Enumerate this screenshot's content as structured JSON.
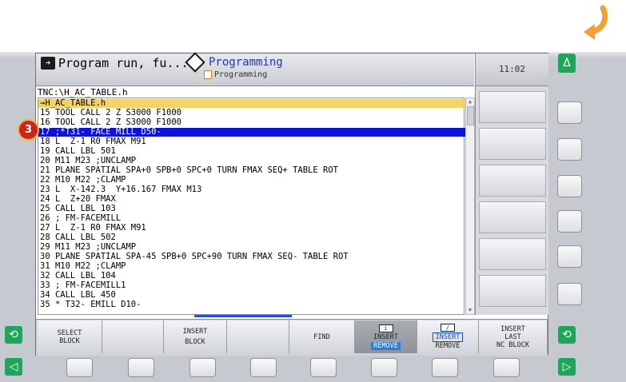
{
  "header": {
    "mode1_label": "Program run, fu...",
    "mode2_label": "Programming",
    "mode2_sub": "Programming",
    "clock": "11:02"
  },
  "file_path": "TNC:\\H_AC_TABLE.h",
  "program_lines": [
    "→H_AC_TABLE.h",
    "15 TOOL CALL 2 Z S3000 F1000",
    "16 TOOL CALL 2 Z S3000 F1000",
    "17 ;*T31- FACE MILL D50-",
    "18 L  Z-1 R0 FMAX M91",
    "19 CALL LBL 501",
    "20 M11 M23 ;UNCLAMP",
    "21 PLANE SPATIAL SPA+0 SPB+0 SPC+0 TURN FMAX SEQ+ TABLE ROT",
    "22 M10 M22 ;CLAMP",
    "23 L  X-142.3  Y+16.167 FMAX M13",
    "24 L  Z+20 FMAX",
    "25 CALL LBL 103",
    "26 ; FM-FACEMILL",
    "27 L  Z-1 R0 FMAX M91",
    "28 CALL LBL 502",
    "29 M11 M23 ;UNCLAMP",
    "30 PLANE SPATIAL SPA-45 SPB+0 SPC+90 TURN FMAX SEQ- TABLE ROT",
    "31 M10 M22 ;CLAMP",
    "32 CALL LBL 104",
    "33 ; FM-FACEMILL1",
    "34 CALL LBL 450",
    "35 * T32- EMILL D10-"
  ],
  "selected_line": "17 ;*T31- FACE MILL D50-",
  "step_badge": "3",
  "softkeys": {
    "sk1_l1": "SELECT",
    "sk1_l2": "BLOCK",
    "sk3_l1": "INSERT",
    "sk3_l2": "BLOCK",
    "sk5": "FIND",
    "sk6_icon": "i",
    "sk6_l1": "INSERT",
    "sk6_l2": "REMOVE",
    "sk7_icon": "/",
    "sk7_l1": "INSERT",
    "sk7_l2": "REMOVE",
    "sk8_l1": "INSERT",
    "sk8_l2": "LAST",
    "sk8_l3": "NC BLOCK"
  },
  "colors": {
    "selection": "#0b14d6",
    "file_header": "#f3d26a",
    "machine_green": "#1fa55a",
    "badge_red": "#c9261d",
    "arrow_orange": "#f2a033"
  },
  "icons": {
    "top_right": "curved-arrow-icon",
    "green_top": "delta-icon",
    "green_left": "refresh-icon",
    "green_right": "refresh-icon",
    "green_bottom_left": "triangle-left-icon",
    "green_bottom_right": "triangle-right-icon"
  }
}
